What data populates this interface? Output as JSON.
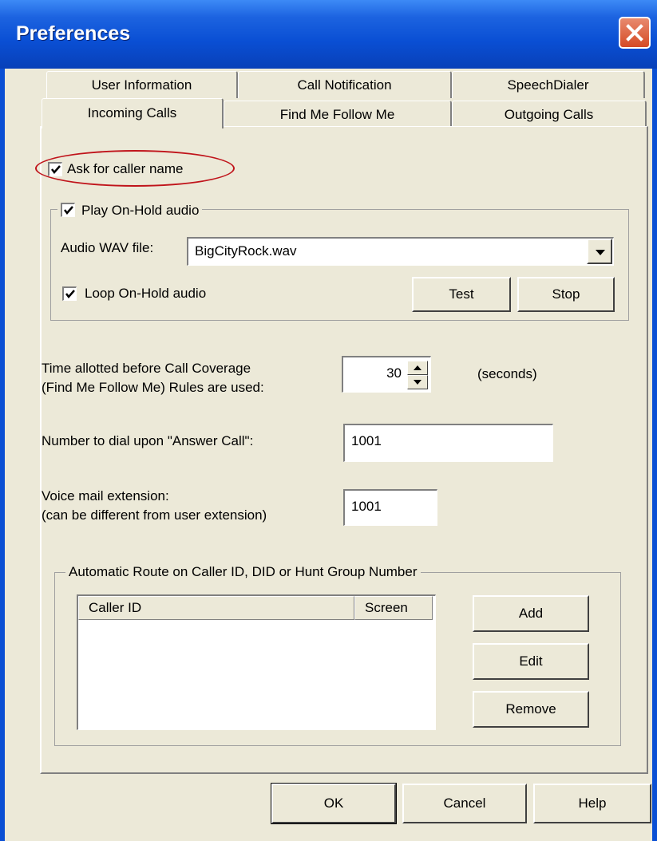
{
  "window": {
    "title": "Preferences"
  },
  "tabs": {
    "row1": [
      "User Information",
      "Call Notification",
      "SpeechDialer"
    ],
    "row2": [
      "Incoming Calls",
      "Find Me Follow Me",
      "Outgoing Calls"
    ],
    "active": "Incoming Calls"
  },
  "incoming": {
    "ask_caller_name": {
      "label": "Ask for caller name",
      "checked": true
    },
    "play_onhold": {
      "label": "Play On-Hold audio",
      "checked": true
    },
    "audio_wav_label": "Audio WAV file:",
    "audio_wav_value": "BigCityRock.wav",
    "loop_onhold": {
      "label": "Loop On-Hold audio",
      "checked": true
    },
    "test_label": "Test",
    "stop_label": "Stop",
    "time_label_line1": "Time allotted before Call Coverage",
    "time_label_line2": "(Find Me Follow Me) Rules are used:",
    "time_value": "30",
    "seconds_label": "(seconds)",
    "answer_call_label": "Number to dial upon \"Answer Call\":",
    "answer_call_value": "1001",
    "voicemail_label_line1": "Voice mail extension:",
    "voicemail_label_line2": "(can be different from user extension)",
    "voicemail_value": "1001",
    "route_group_title": "Automatic Route on Caller ID, DID or Hunt Group Number",
    "route_columns": [
      "Caller ID",
      "Screen"
    ],
    "route_rows": [],
    "add_label": "Add",
    "edit_label": "Edit",
    "remove_label": "Remove"
  },
  "footer": {
    "ok_label": "OK",
    "cancel_label": "Cancel",
    "help_label": "Help"
  },
  "icons": {
    "close": "close-icon",
    "check": "checkmark-icon",
    "dropdown": "chevron-down-icon",
    "spin_up": "spin-up-icon",
    "spin_down": "spin-down-icon"
  },
  "colors": {
    "title_bar": "#0a4fd4",
    "close_button": "#d54a25",
    "dialog_bg": "#ece9d8",
    "annotation_oval": "#c0141b"
  }
}
